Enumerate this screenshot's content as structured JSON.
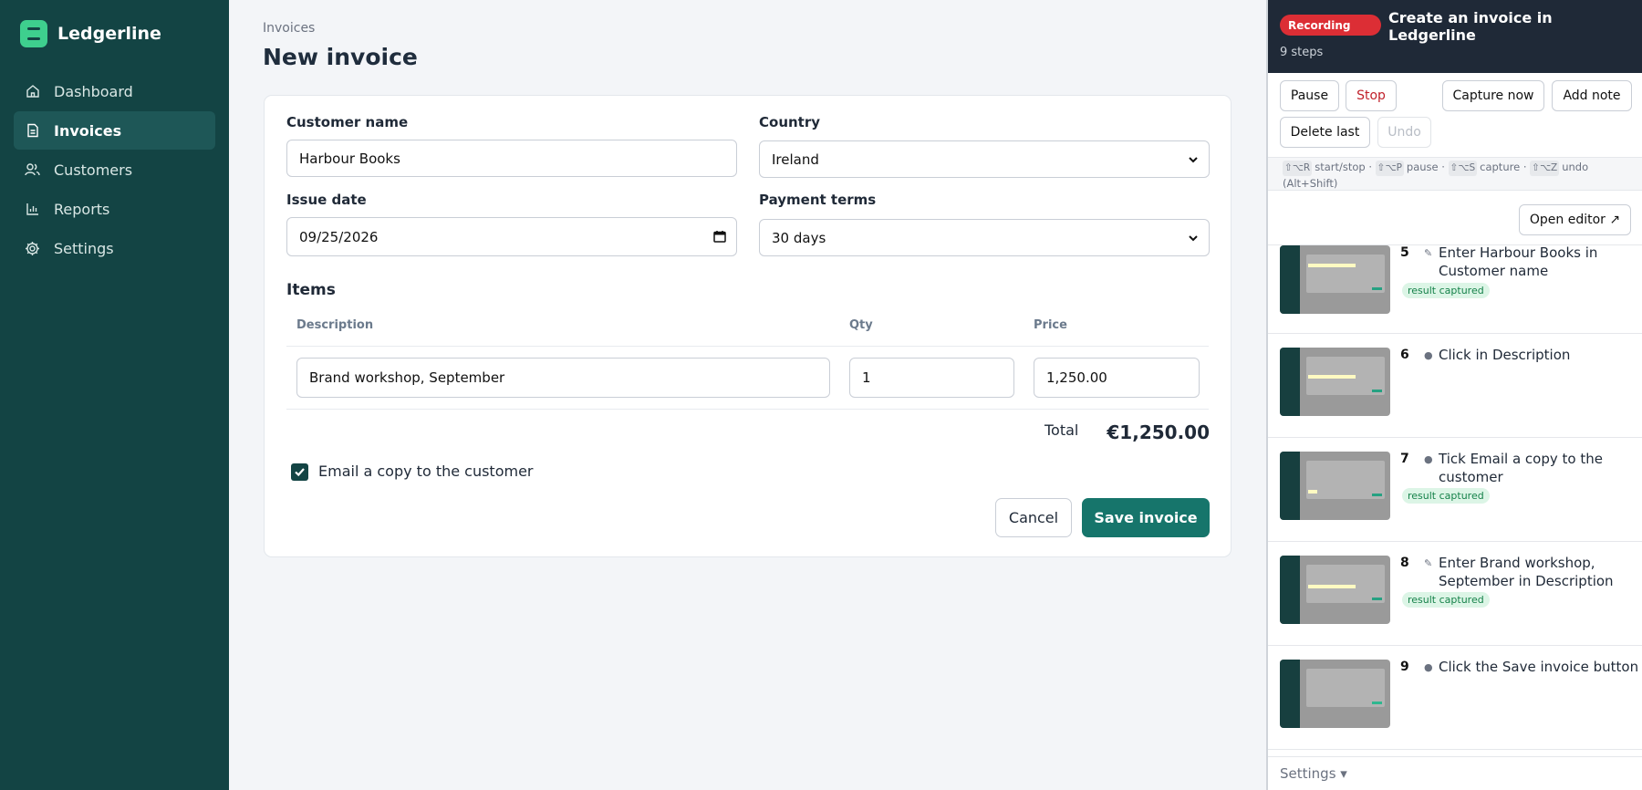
{
  "app": {
    "name": "Ledgerline"
  },
  "sidebar": {
    "items": [
      {
        "label": "Dashboard",
        "icon": "home-icon",
        "active": false
      },
      {
        "label": "Invoices",
        "icon": "document-icon",
        "active": true
      },
      {
        "label": "Customers",
        "icon": "users-icon",
        "active": false
      },
      {
        "label": "Reports",
        "icon": "bar-chart-icon",
        "active": false
      },
      {
        "label": "Settings",
        "icon": "gear-icon",
        "active": false
      }
    ]
  },
  "main": {
    "breadcrumb": "Invoices",
    "title": "New invoice",
    "form": {
      "customer_label": "Customer name",
      "customer_value": "Harbour Books",
      "country_label": "Country",
      "country_value": "Ireland",
      "issue_date_label": "Issue date",
      "issue_date_value": "09/25/2026",
      "terms_label": "Payment terms",
      "terms_value": "30 days",
      "items_heading": "Items",
      "columns": [
        "Description",
        "Qty",
        "Price"
      ],
      "items": [
        {
          "description": "Brand workshop, September",
          "qty": "1",
          "price": "1,250.00"
        }
      ],
      "total_label": "Total",
      "total_value": "€1,250.00",
      "email_copy_label": "Email a copy to the customer",
      "email_copy_checked": true,
      "cancel_label": "Cancel",
      "save_label": "Save invoice"
    }
  },
  "recorder": {
    "status": "Recording",
    "title": "Create an invoice in Ledgerline",
    "steps_count": "9 steps",
    "buttons": {
      "pause": "Pause",
      "stop": "Stop",
      "capture": "Capture now",
      "add_note": "Add note",
      "delete_last": "Delete last",
      "undo": "Undo"
    },
    "hotkeys": [
      {
        "key": "⇧⌥R",
        "action": "start/stop ·"
      },
      {
        "key": "⇧⌥P",
        "action": "pause ·"
      },
      {
        "key": "⇧⌥S",
        "action": "capture ·"
      },
      {
        "key": "⇧⌥Z",
        "action": "undo"
      }
    ],
    "hotkeys_note": "(Alt+Shift)",
    "open_editor": "Open editor ↗",
    "steps": [
      {
        "num": "5",
        "icon": "✎",
        "text": "Enter Harbour Books in Customer name",
        "badge": "result captured"
      },
      {
        "num": "6",
        "icon": "●",
        "text": "Click in Description",
        "badge": ""
      },
      {
        "num": "7",
        "icon": "●",
        "text": "Tick Email a copy to the customer",
        "badge": "result captured"
      },
      {
        "num": "8",
        "icon": "✎",
        "text": "Enter Brand workshop, September in Description",
        "badge": "result captured"
      },
      {
        "num": "9",
        "icon": "●",
        "text": "Click the Save invoice button",
        "badge": ""
      }
    ],
    "footer": "Settings ▾"
  },
  "colors": {
    "sidebar": "#134444",
    "accent": "#16756b",
    "recording": "#dc2e35"
  }
}
